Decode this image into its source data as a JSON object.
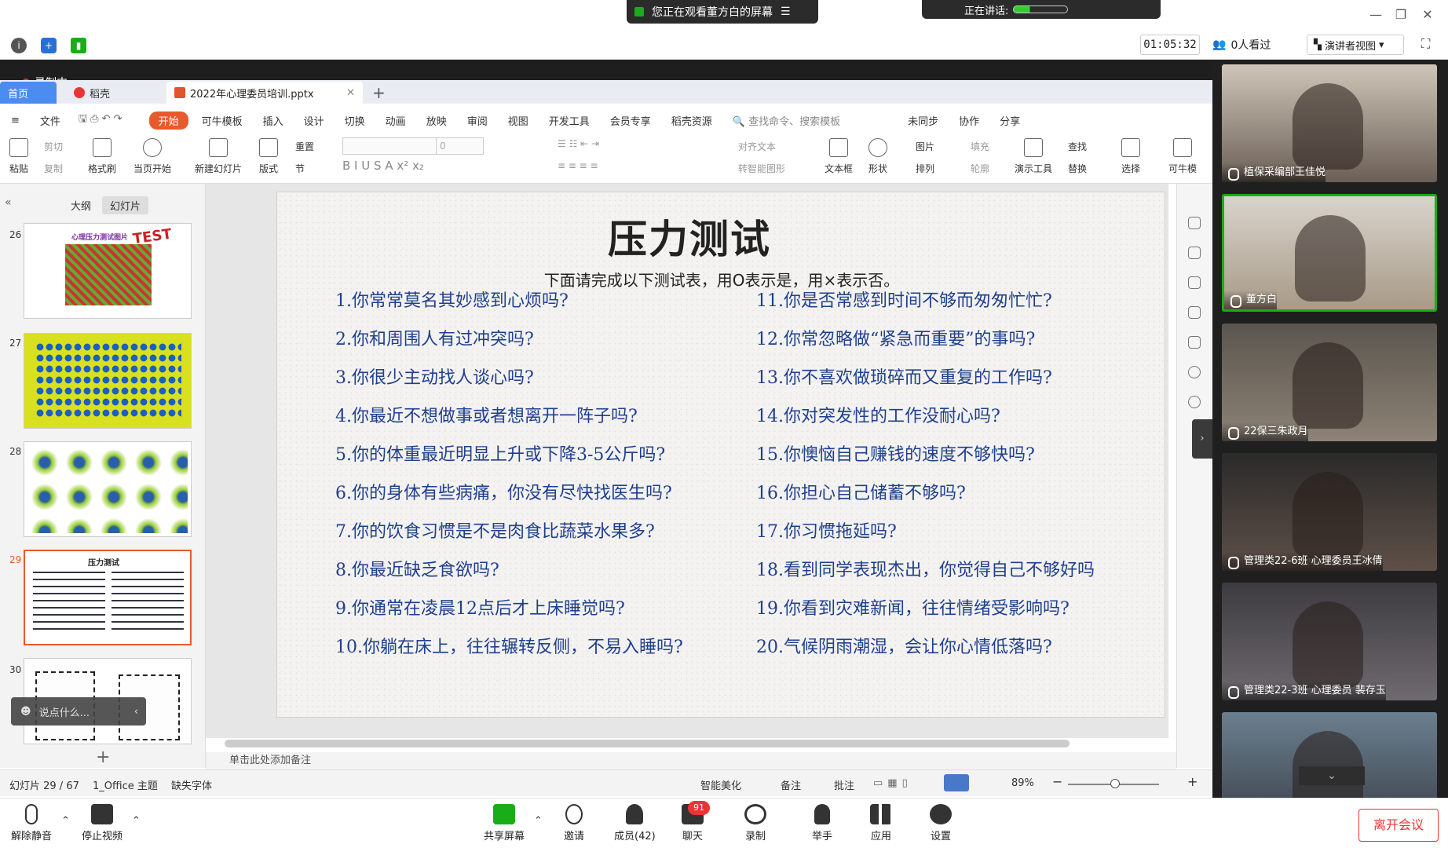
{
  "topbar": {
    "share_banner": "您正在观看董方白的屏幕",
    "speaking": "正在讲话:",
    "minimize": "—",
    "restore": "❐",
    "close": "✕"
  },
  "meetbar": {
    "timer": "01:05:32",
    "viewers": "0人看过",
    "speaker_view": "演讲者视图"
  },
  "recording": {
    "label": "录制中"
  },
  "wps": {
    "tabs": {
      "home": "首页",
      "daoke": "稻壳",
      "file": "2022年心理委员培训.pptx"
    },
    "menu": [
      "文件",
      "开始",
      "可牛模板",
      "插入",
      "设计",
      "切换",
      "动画",
      "放映",
      "审阅",
      "视图",
      "开发工具",
      "会员专享",
      "稻壳资源"
    ],
    "search_placeholder": "查找命令、搜索模板",
    "menu_right": [
      "未同步",
      "协作",
      "分享"
    ],
    "ribbon": {
      "paste": "粘贴",
      "cut": "剪切",
      "copy": "复制",
      "format_painter": "格式刷",
      "play_current": "当页开始",
      "new_slide": "新建幻灯片",
      "layout": "版式",
      "reset": "重置",
      "section": "节",
      "size_value": "0",
      "align_text": "对齐文本",
      "convert_smartart": "转智能图形",
      "textbox": "文本框",
      "shape": "形状",
      "picture": "图片",
      "arrange": "排列",
      "fill": "填充",
      "outline": "轮廓",
      "present_tools": "演示工具",
      "find": "查找",
      "replace": "替换",
      "select": "选择",
      "keniu": "可牛模"
    },
    "pane_tabs": {
      "outline": "大纲",
      "slides": "幻灯片"
    },
    "thumb_numbers": {
      "t26": "26",
      "t27": "27",
      "t28": "28",
      "t29": "29",
      "t30": "30"
    },
    "thumb26_title": "心理压力测试图片",
    "thumb26_test": "TEST",
    "thumb29_title": "压力测试",
    "chat_placeholder": "说点什么...",
    "notes_placeholder": "单击此处添加备注",
    "status": {
      "slide_count": "幻灯片 29 / 67",
      "theme": "1_Office 主题",
      "missing_font": "缺失字体",
      "beautify": "智能美化",
      "notes": "备注",
      "comment": "批注",
      "zoom": "89%"
    }
  },
  "slide": {
    "title": "压力测试",
    "subtitle": "下面请完成以下测试表，用O表示是，用×表示否。",
    "left_questions": [
      "1.你常常莫名其妙感到心烦吗?",
      "2.你和周围人有过冲突吗?",
      "3.你很少主动找人谈心吗?",
      "4.你最近不想做事或者想离开一阵子吗?",
      "5.你的体重最近明显上升或下降3-5公斤吗?",
      "6.你的身体有些病痛，你没有尽快找医生吗?",
      "7.你的饮食习惯是不是肉食比蔬菜水果多?",
      "8.你最近缺乏食欲吗?",
      "9.你通常在凌晨12点后才上床睡觉吗?",
      "10.你躺在床上，往往辗转反侧，不易入睡吗?"
    ],
    "right_questions": [
      "11.你是否常感到时间不够而匆匆忙忙?",
      "12.你常忽略做“紧急而重要”的事吗?",
      "13.你不喜欢做琐碎而又重复的工作吗?",
      "14.你对突发性的工作没耐心吗?",
      "15.你懊恼自己赚钱的速度不够快吗?",
      "16.你担心自己储蓄不够吗?",
      "17.你习惯拖延吗?",
      "18.看到同学表现杰出，你觉得自己不够好吗",
      "19.你看到灾难新闻，往往情绪受影响吗?",
      "20.气候阴雨潮湿，会让你心情低落吗?"
    ]
  },
  "participants": [
    {
      "name": "植保采编部王佳悦"
    },
    {
      "name": "董方白"
    },
    {
      "name": "22保三朱政月"
    },
    {
      "name": "管理类22-6班 心理委员王冰倩"
    },
    {
      "name": "管理类22-3班 心理委员 裴存玉"
    },
    {
      "name": ""
    }
  ],
  "bottombar": {
    "mute": "解除静音",
    "stop_video": "停止视频",
    "share": "共享屏幕",
    "invite": "邀请",
    "members": "成员(42)",
    "chat": "聊天",
    "chat_badge": "91",
    "record": "录制",
    "raise_hand": "举手",
    "apps": "应用",
    "settings": "设置",
    "leave": "离开会议"
  },
  "colors": {
    "wps_accent": "#e85a2c",
    "home_tab": "#4a8cf0",
    "question_text": "#1f3f8f",
    "leave": "#e33333",
    "active_speaker": "#1aad19"
  }
}
